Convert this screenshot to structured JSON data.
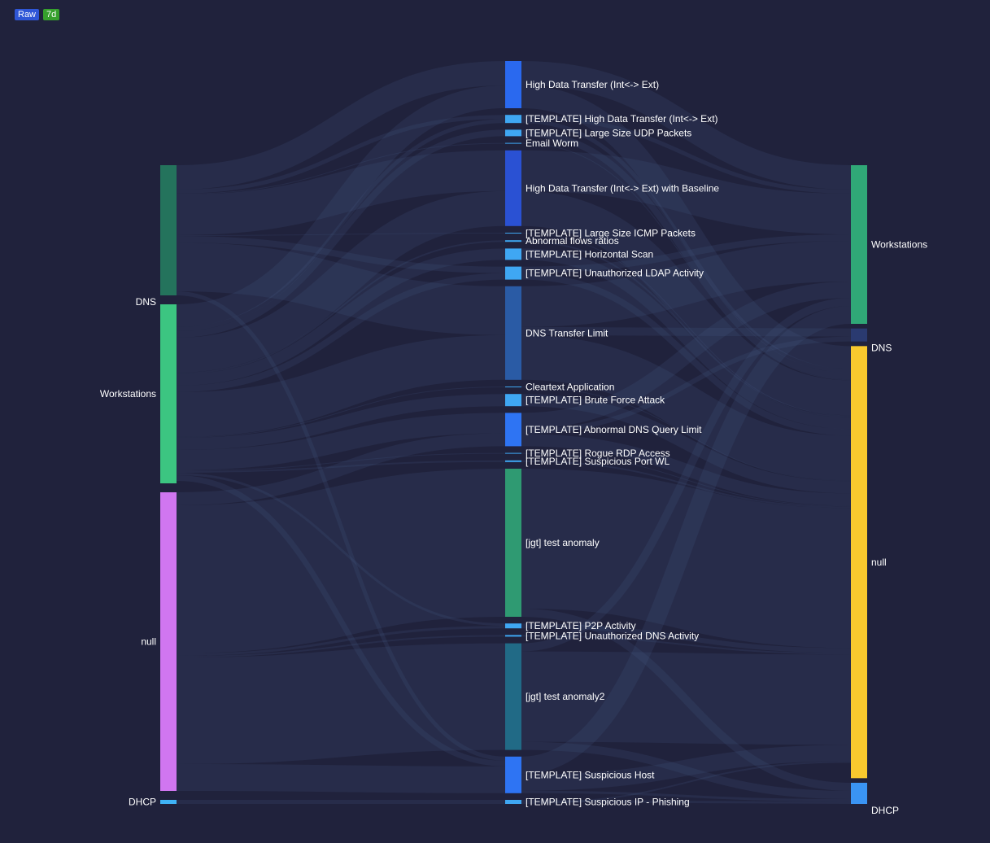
{
  "toolbar": {
    "raw_label": "Raw",
    "range_label": "7d",
    "colors": {
      "raw": "#2f56d6",
      "range": "#36a02d"
    }
  },
  "sankey": {
    "background": "#20223c",
    "link_color": "#4a5c8c",
    "left_nodes": [
      {
        "name": "DNS",
        "color": "#24735c",
        "label_pos": "bottom",
        "value": 160
      },
      {
        "name": "Workstations",
        "color": "#3cc581",
        "label_pos": "middle",
        "value": 220
      },
      {
        "name": "null",
        "color": "#d076f0",
        "label_pos": "middle",
        "value": 367
      },
      {
        "name": "DHCP",
        "color": "#3fb3f6",
        "label_pos": "middle",
        "value": 5
      }
    ],
    "middle_nodes": [
      {
        "name": "High Data Transfer (Int<-> Ext)",
        "color": "#2a69ef",
        "value": 58
      },
      {
        "name": "[TEMPLATE] High Data Transfer (Int<-> Ext)",
        "color": "#3fa7f3",
        "value": 10
      },
      {
        "name": "[TEMPLATE] Large Size UDP Packets",
        "color": "#3fa7f3",
        "value": 8
      },
      {
        "name": "Email Worm",
        "color": "#3fa7f3",
        "value": 1
      },
      {
        "name": "High Data Transfer (Int<-> Ext) with Baseline",
        "color": "#2a51d3",
        "value": 93
      },
      {
        "name": "[TEMPLATE] Large Size ICMP Packets",
        "color": "#3fa7f3",
        "value": 1
      },
      {
        "name": "Abnormal flows ratios",
        "color": "#3fa7f3",
        "value": 2
      },
      {
        "name": "[TEMPLATE] Horizontal Scan",
        "color": "#3fa7f3",
        "value": 14
      },
      {
        "name": "[TEMPLATE] Unauthorized LDAP Activity",
        "color": "#3fa7f3",
        "value": 16
      },
      {
        "name": "DNS Transfer Limit",
        "color": "#2a5ba5",
        "value": 115
      },
      {
        "name": "Cleartext Application",
        "color": "#3fa7f3",
        "value": 1
      },
      {
        "name": "[TEMPLATE] Brute Force Attack",
        "color": "#3fa7f3",
        "value": 15
      },
      {
        "name": "[TEMPLATE] Abnormal DNS Query Limit",
        "color": "#2e74f3",
        "value": 41
      },
      {
        "name": "[TEMPLATE] Rogue RDP Access",
        "color": "#3fa7f3",
        "value": 1
      },
      {
        "name": "[TEMPLATE] Suspicious Port WL",
        "color": "#3fa7f3",
        "value": 2
      },
      {
        "name": "[jgt] test anomaly",
        "color": "#2f9a72",
        "value": 182
      },
      {
        "name": "[TEMPLATE] P2P Activity",
        "color": "#3fa7f3",
        "value": 6
      },
      {
        "name": "[TEMPLATE] Unauthorized DNS Activity",
        "color": "#3fa7f3",
        "value": 2
      },
      {
        "name": "[jgt] test anomaly2",
        "color": "#216a86",
        "value": 131
      },
      {
        "name": "[TEMPLATE] Suspicious Host",
        "color": "#2e74f3",
        "value": 45
      },
      {
        "name": "[TEMPLATE] Suspicious IP - Phishing",
        "color": "#3fa7f3",
        "value": 5
      }
    ],
    "right_nodes": [
      {
        "name": "Workstations",
        "color": "#30a877",
        "label_pos": "middle",
        "value": 195
      },
      {
        "name": "DNS",
        "color": "#2a3a70",
        "label_pos": "bottom",
        "value": 16
      },
      {
        "name": "null",
        "color": "#f9c92e",
        "label_pos": "middle",
        "value": 531
      },
      {
        "name": "DHCP",
        "color": "#3a94f3",
        "label_pos": "bottom",
        "value": 26
      }
    ],
    "links": [
      {
        "source": "DNS",
        "target": "High Data Transfer (Int<-> Ext)",
        "value": 30
      },
      {
        "source": "Workstations",
        "target": "High Data Transfer (Int<-> Ext)",
        "value": 28
      },
      {
        "source": "DNS",
        "target": "[TEMPLATE] High Data Transfer (Int<-> Ext)",
        "value": 5
      },
      {
        "source": "Workstations",
        "target": "[TEMPLATE] High Data Transfer (Int<-> Ext)",
        "value": 5
      },
      {
        "source": "Workstations",
        "target": "[TEMPLATE] Large Size UDP Packets",
        "value": 8
      },
      {
        "source": "DNS",
        "target": "Email Worm",
        "value": 1
      },
      {
        "source": "DNS",
        "target": "High Data Transfer (Int<-> Ext) with Baseline",
        "value": 50
      },
      {
        "source": "Workstations",
        "target": "High Data Transfer (Int<-> Ext) with Baseline",
        "value": 43
      },
      {
        "source": "DNS",
        "target": "[TEMPLATE] Large Size ICMP Packets",
        "value": 1
      },
      {
        "source": "Workstations",
        "target": "Abnormal flows ratios",
        "value": 2
      },
      {
        "source": "Workstations",
        "target": "[TEMPLATE] Horizontal Scan",
        "value": 14
      },
      {
        "source": "DNS",
        "target": "[TEMPLATE] Unauthorized LDAP Activity",
        "value": 8
      },
      {
        "source": "Workstations",
        "target": "[TEMPLATE] Unauthorized LDAP Activity",
        "value": 8
      },
      {
        "source": "DNS",
        "target": "DNS Transfer Limit",
        "value": 60
      },
      {
        "source": "Workstations",
        "target": "DNS Transfer Limit",
        "value": 55
      },
      {
        "source": "Workstations",
        "target": "Cleartext Application",
        "value": 1
      },
      {
        "source": "Workstations",
        "target": "[TEMPLATE] Brute Force Attack",
        "value": 15
      },
      {
        "source": "Workstations",
        "target": "[TEMPLATE] Abnormal DNS Query Limit",
        "value": 25
      },
      {
        "source": "null",
        "target": "[TEMPLATE] Abnormal DNS Query Limit",
        "value": 16
      },
      {
        "source": "Workstations",
        "target": "[TEMPLATE] Rogue RDP Access",
        "value": 1
      },
      {
        "source": "Workstations",
        "target": "[TEMPLATE] Suspicious Port WL",
        "value": 2
      },
      {
        "source": "null",
        "target": "[jgt] test anomaly",
        "value": 182
      },
      {
        "source": "Workstations",
        "target": "[TEMPLATE] P2P Activity",
        "value": 3
      },
      {
        "source": "null",
        "target": "[TEMPLATE] P2P Activity",
        "value": 3
      },
      {
        "source": "null",
        "target": "[TEMPLATE] Unauthorized DNS Activity",
        "value": 2
      },
      {
        "source": "null",
        "target": "[jgt] test anomaly2",
        "value": 131
      },
      {
        "source": "DNS",
        "target": "[TEMPLATE] Suspicious Host",
        "value": 5
      },
      {
        "source": "Workstations",
        "target": "[TEMPLATE] Suspicious Host",
        "value": 7
      },
      {
        "source": "null",
        "target": "[TEMPLATE] Suspicious Host",
        "value": 33
      },
      {
        "source": "DHCP",
        "target": "[TEMPLATE] Suspicious IP - Phishing",
        "value": 5
      },
      {
        "source": "High Data Transfer (Int<-> Ext)",
        "target": "Workstations",
        "value": 30
      },
      {
        "source": "High Data Transfer (Int<-> Ext)",
        "target": "null",
        "value": 28
      },
      {
        "source": "[TEMPLATE] High Data Transfer (Int<-> Ext)",
        "target": "Workstations",
        "value": 5
      },
      {
        "source": "[TEMPLATE] High Data Transfer (Int<-> Ext)",
        "target": "null",
        "value": 5
      },
      {
        "source": "[TEMPLATE] Large Size UDP Packets",
        "target": "null",
        "value": 8
      },
      {
        "source": "Email Worm",
        "target": "null",
        "value": 1
      },
      {
        "source": "High Data Transfer (Int<-> Ext) with Baseline",
        "target": "Workstations",
        "value": 50
      },
      {
        "source": "High Data Transfer (Int<-> Ext) with Baseline",
        "target": "null",
        "value": 43
      },
      {
        "source": "[TEMPLATE] Large Size ICMP Packets",
        "target": "null",
        "value": 1
      },
      {
        "source": "Abnormal flows ratios",
        "target": "null",
        "value": 2
      },
      {
        "source": "[TEMPLATE] Horizontal Scan",
        "target": "null",
        "value": 14
      },
      {
        "source": "[TEMPLATE] Unauthorized LDAP Activity",
        "target": "Workstations",
        "value": 8
      },
      {
        "source": "[TEMPLATE] Unauthorized LDAP Activity",
        "target": "null",
        "value": 8
      },
      {
        "source": "DNS Transfer Limit",
        "target": "Workstations",
        "value": 50
      },
      {
        "source": "DNS Transfer Limit",
        "target": "DNS",
        "value": 10
      },
      {
        "source": "DNS Transfer Limit",
        "target": "null",
        "value": 55
      },
      {
        "source": "Cleartext Application",
        "target": "null",
        "value": 1
      },
      {
        "source": "[TEMPLATE] Brute Force Attack",
        "target": "null",
        "value": 15
      },
      {
        "source": "[TEMPLATE] Abnormal DNS Query Limit",
        "target": "Workstations",
        "value": 20
      },
      {
        "source": "[TEMPLATE] Abnormal DNS Query Limit",
        "target": "DNS",
        "value": 6
      },
      {
        "source": "[TEMPLATE] Abnormal DNS Query Limit",
        "target": "null",
        "value": 15
      },
      {
        "source": "[TEMPLATE] Rogue RDP Access",
        "target": "null",
        "value": 1
      },
      {
        "source": "[TEMPLATE] Suspicious Port WL",
        "target": "null",
        "value": 2
      },
      {
        "source": "[jgt] test anomaly",
        "target": "null",
        "value": 172
      },
      {
        "source": "[jgt] test anomaly",
        "target": "DHCP",
        "value": 10
      },
      {
        "source": "[TEMPLATE] P2P Activity",
        "target": "null",
        "value": 6
      },
      {
        "source": "[TEMPLATE] Unauthorized DNS Activity",
        "target": "null",
        "value": 2
      },
      {
        "source": "[jgt] test anomaly2",
        "target": "Workstations",
        "value": 10
      },
      {
        "source": "[jgt] test anomaly2",
        "target": "null",
        "value": 111
      },
      {
        "source": "[jgt] test anomaly2",
        "target": "DHCP",
        "value": 10
      },
      {
        "source": "[TEMPLATE] Suspicious Host",
        "target": "Workstations",
        "value": 22
      },
      {
        "source": "[TEMPLATE] Suspicious Host",
        "target": "null",
        "value": 20
      },
      {
        "source": "[TEMPLATE] Suspicious Host",
        "target": "DHCP",
        "value": 3
      },
      {
        "source": "[TEMPLATE] Suspicious IP - Phishing",
        "target": "DHCP",
        "value": 3
      },
      {
        "source": "[TEMPLATE] Suspicious IP - Phishing",
        "target": "null",
        "value": 2
      }
    ]
  }
}
